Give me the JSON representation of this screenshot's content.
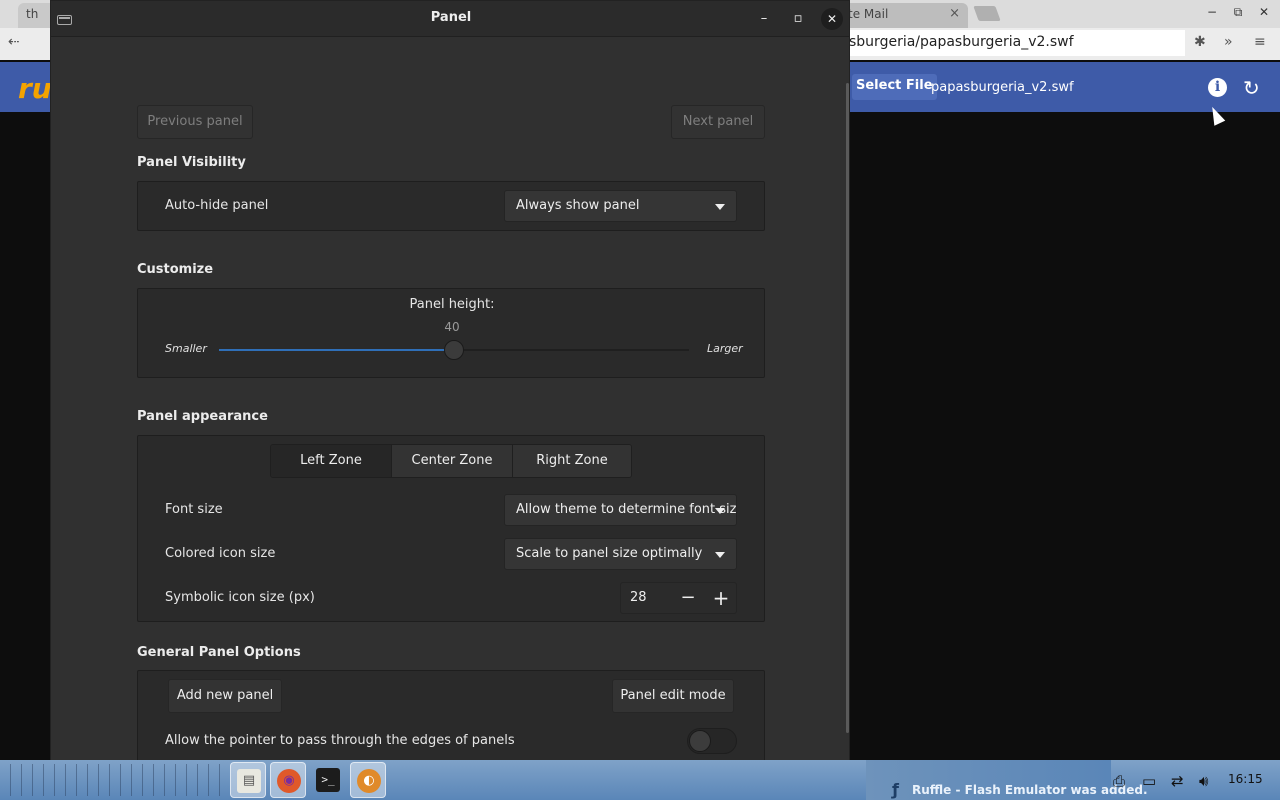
{
  "browser": {
    "left_tab_label": "th",
    "mail_tab_label": "te Mail",
    "mail_tab_close": "×",
    "url": "sburgeria/papasburgeria_v2.swf",
    "extensions_icon": "puzzle-icon",
    "overflow_label": "»",
    "menu_label": "≡",
    "window_minimize": "−",
    "window_restore": "⧉",
    "window_close": "✕"
  },
  "ruffle": {
    "logo_text": "ru",
    "select_file_label": "Select File",
    "filename": "papasburgeria_v2.swf",
    "info_icon_label": "i",
    "reload_icon_label": "↻",
    "bar_color": "#3e5ba8"
  },
  "dialog": {
    "title": "Panel",
    "minimize_label": "–",
    "maximize_label": "▫",
    "close_label": "✕",
    "nav": {
      "previous_label": "Previous panel",
      "next_label": "Next panel"
    },
    "visibility": {
      "heading": "Panel Visibility",
      "autohide_label": "Auto-hide panel",
      "autohide_value": "Always show panel"
    },
    "customize": {
      "heading": "Customize",
      "height_label": "Panel height:",
      "height_value": "40",
      "height_fraction": 0.5,
      "min_label": "Smaller",
      "max_label": "Larger"
    },
    "appearance": {
      "heading": "Panel appearance",
      "tabs": [
        "Left Zone",
        "Center Zone",
        "Right Zone"
      ],
      "active_tab": "Left Zone",
      "font_size_label": "Font size",
      "font_size_value": "Allow theme to determine font size",
      "colored_icon_label": "Colored icon size",
      "colored_icon_value": "Scale to panel size optimally",
      "symbolic_icon_label": "Symbolic icon size (px)",
      "symbolic_icon_value": "28",
      "minus_label": "−",
      "plus_label": "+"
    },
    "general": {
      "heading": "General Panel Options",
      "add_panel_label": "Add new panel",
      "edit_mode_label": "Panel edit mode",
      "pointer_label": "Allow the pointer to pass through the edges of panels",
      "pointer_enabled": false
    }
  },
  "taskbar": {
    "apps": [
      {
        "name": "file-manager-icon",
        "glyph": "▤",
        "active": true
      },
      {
        "name": "firefox-icon",
        "glyph": "◉",
        "active": true
      },
      {
        "name": "terminal-icon",
        "glyph": ">_",
        "active": false
      },
      {
        "name": "cinnamon-settings-icon",
        "glyph": "◐",
        "active": true
      }
    ],
    "notification": "Ruffle - Flash Emulator was added.",
    "notification_icon": "ruffle-icon",
    "tray": [
      "printer-icon",
      "display-icon",
      "network-icon",
      "volume-icon"
    ],
    "clock": "16:15"
  }
}
